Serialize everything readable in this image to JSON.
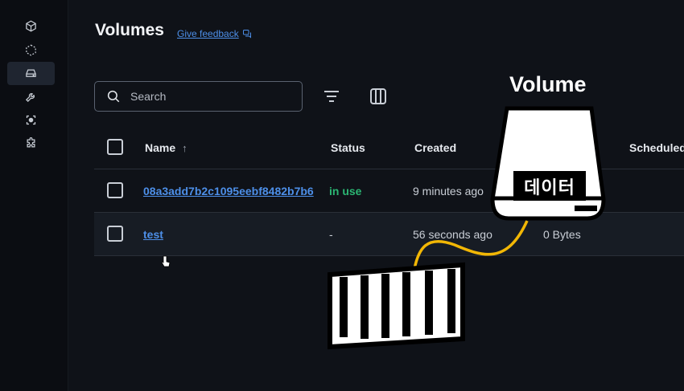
{
  "header": {
    "title": "Volumes",
    "feedback_label": "Give feedback"
  },
  "search": {
    "placeholder": "Search",
    "value": ""
  },
  "sidebar": {
    "items": [
      {
        "icon": "cube-icon",
        "active": false
      },
      {
        "icon": "container-dashed-icon",
        "active": false
      },
      {
        "icon": "drive-icon",
        "active": true
      },
      {
        "icon": "wrench-icon",
        "active": false
      },
      {
        "icon": "scan-icon",
        "active": false
      },
      {
        "icon": "puzzle-icon",
        "active": false
      }
    ]
  },
  "table": {
    "columns": {
      "name": "Name",
      "status": "Status",
      "created": "Created",
      "scheduled": "Scheduled"
    },
    "rows": [
      {
        "name": "08a3add7b2c1095eebf8482b7b6",
        "status": "in use",
        "created": "9 minutes ago",
        "size": ""
      },
      {
        "name": "test",
        "status": "-",
        "created": "56 seconds ago",
        "size": "0 Bytes"
      }
    ]
  },
  "overlay": {
    "volume_label": "Volume",
    "data_label": "데이터"
  },
  "colors": {
    "background": "#0f1218",
    "accent": "#4d8fe8",
    "status_ok": "#2bb673",
    "cable": "#f2b705"
  }
}
